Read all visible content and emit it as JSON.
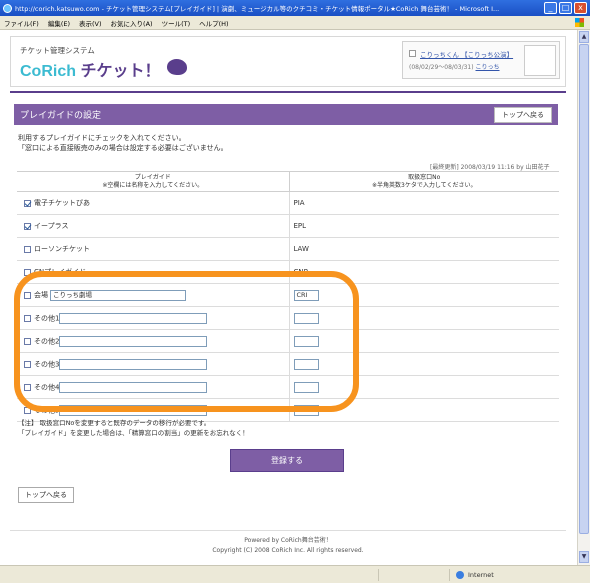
{
  "window": {
    "title": "http://corich.katsuwo.com - チケット管理システム[プレイガイド] | 演劇、ミュージカル等のクチコミ・チケット情報ポータル★CoRich 舞台芸術！ - Microsoft I...",
    "min": "_",
    "max": "□",
    "close": "x"
  },
  "menu": [
    "ファイル(F)",
    "編集(E)",
    "表示(V)",
    "お気に入り(A)",
    "ツール(T)",
    "ヘルプ(H)"
  ],
  "header": {
    "logo_sub": "チケット管理システム",
    "logo_brand": "CoRich",
    "logo_ticket": "チケット！",
    "user_link": "こりっちくん 【こりっち公演】",
    "user_period": "(08/02/29〜08/03/31)",
    "user_period_link": "こりっち"
  },
  "section": {
    "title": "プレイガイドの設定",
    "top_button": "トップへ戻る"
  },
  "intro": {
    "line1": "利用するプレイガイドにチェックを入れてください。",
    "line2": "「窓口による直接販売のみの場合は設定する必要はございません。"
  },
  "updated": "[最終更新] 2008/03/19 11:16 by 山田花子",
  "table": {
    "head_col1_l1": "プレイガイド",
    "head_col1_l2": "※空欄には名称を入力してください。",
    "head_col2_l1": "取扱窓口No",
    "head_col2_l2": "※半角英数3ケタで入力してください。",
    "rows": [
      {
        "label": "電子チケットぴあ",
        "checked": true,
        "code": "PIA"
      },
      {
        "label": "イープラス",
        "checked": true,
        "code": "EPL"
      },
      {
        "label": "ローソンチケット",
        "checked": false,
        "code": "LAW"
      },
      {
        "label": "CNプレイガイド",
        "checked": false,
        "code": "CNP"
      },
      {
        "label": "会場",
        "checked": false,
        "input": "こりっち劇場",
        "code": "CRI"
      },
      {
        "label": "その他1",
        "checked": false,
        "input": "",
        "code": ""
      },
      {
        "label": "その他2",
        "checked": false,
        "input": "",
        "code": ""
      },
      {
        "label": "その他3",
        "checked": false,
        "input": "",
        "code": ""
      },
      {
        "label": "その他4",
        "checked": false,
        "input": "",
        "code": ""
      },
      {
        "label": "その他5",
        "checked": false,
        "input": "",
        "code": ""
      }
    ]
  },
  "note": {
    "line1": "【注】 取扱窓口Noを変更すると既存のデータの移行が必要です。",
    "line2": "「プレイガイド」を変更した場合は、「精算窓口の割当」の更新をお忘れなく！"
  },
  "submit_label": "登録する",
  "back_label": "トップへ戻る",
  "footer": {
    "line1": "Powered by  CoRich舞台芸術！",
    "line2": "Copyright (C) 2008 CoRich Inc. All rights reserved."
  },
  "status": {
    "zone": "インターネット",
    "zone_label": "Internet"
  }
}
